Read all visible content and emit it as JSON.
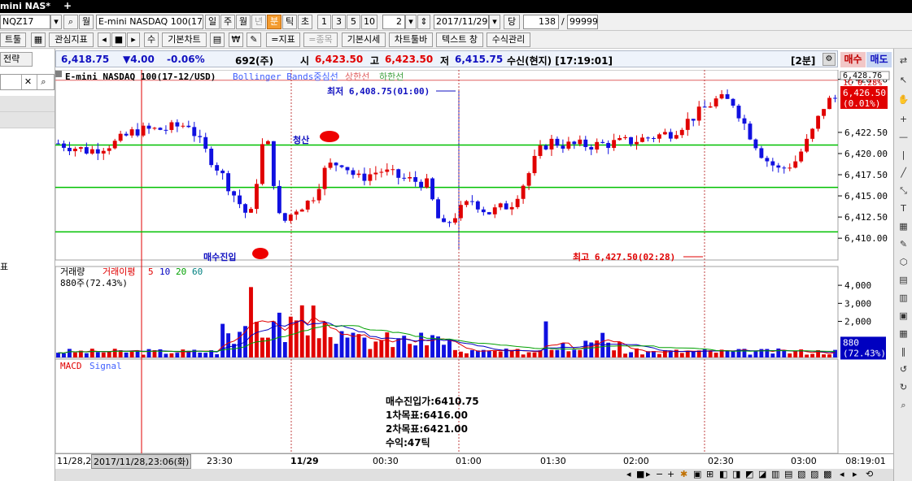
{
  "window": {
    "tab_title": "mini NAS*",
    "new_tab": "+"
  },
  "toolbar1": {
    "symbol": "NQZ17",
    "search_icon": "search-icon",
    "month_label": "월",
    "product_name": "E-mini NASDAQ 100(17-",
    "periods": [
      "일",
      "주",
      "월",
      "년",
      "분",
      "틱",
      "초"
    ],
    "active_period": "분",
    "intervals": [
      "1",
      "3",
      "5",
      "10"
    ],
    "interval_value": "2",
    "date": "2017/11/29",
    "dang_label": "당",
    "count": "138",
    "slash": "/",
    "max_count": "99999"
  },
  "toolbar2": {
    "first": "트툴",
    "interest_indicator": "관심지표",
    "number_label": "수",
    "basic_chart": "기본차트",
    "won_symbol": "₩",
    "indicator_btn": "=지표",
    "item_btn": "=종목",
    "basic_quote": "기본시세",
    "chart_toolbar": "차트툴바",
    "text_window": "텍스트 창",
    "formula_manage": "수식관리"
  },
  "left_panel": {
    "header": "전략",
    "item_label": "표"
  },
  "quote": {
    "price": "6,418.75",
    "change": "▼4.00",
    "change_pct": "-0.06%",
    "volume": "692(주)",
    "open_label": "시",
    "open": "6,423.50",
    "high_label": "고",
    "high": "6,423.50",
    "low_label": "저",
    "low": "6,415.75",
    "status": "수신(현지) [17:19:01]",
    "interval_tag": "[2분]",
    "buy_label": "매수",
    "sell_label": "매도"
  },
  "chart_data": [
    {
      "type": "candlestick",
      "title": "E-mini NASDAQ 100(17-12/USD)",
      "legend": [
        "Bollinger Bands중심선",
        "상한선",
        "하한선"
      ],
      "colors": {
        "up": "#e00000",
        "down": "#1010e0",
        "hline": "#00c000",
        "ma": "#0a8a0a"
      },
      "y_ticks": [
        "6,428.76",
        "6,422.50",
        "6,420.00",
        "6,417.50",
        "6,415.00",
        "6,412.50",
        "6,410.00"
      ],
      "ylim": [
        6408.0,
        6429.5
      ],
      "horizontal_lines": [
        6421.0,
        6416.0,
        6410.75
      ],
      "last_price_box": "6,426.50",
      "last_pct_box": "(0.01%)",
      "top_label": "1C 0.28%",
      "annotations": {
        "low_text": "최저 6,408.75(01:00)",
        "high_text": "최고 6,427.50(02:28)",
        "exit_label": "청산",
        "entry_label": "매수진입"
      }
    },
    {
      "type": "bar",
      "title": "거래량",
      "legend": [
        "거래이평",
        "5",
        "10",
        "20",
        "60"
      ],
      "info": "880주(72.43%)",
      "y_ticks": [
        "4,000",
        "3,000",
        "2,000"
      ],
      "ylim": [
        0,
        4500
      ],
      "last_value": "880",
      "last_pct": "(72.43%)"
    },
    {
      "type": "line",
      "title": "MACD",
      "legend": [
        "Signal"
      ]
    }
  ],
  "strategy_note": {
    "entry": "매수진입가:6410.75",
    "target1": "1차목표:6416.00",
    "target2": "2차목표:6421.00",
    "profit": "수익:47틱"
  },
  "xaxis": {
    "ticks": [
      "11/28,2",
      "2017/11/28,23:06(화)",
      "23:30",
      "11/29",
      "00:30",
      "01:00",
      "01:30",
      "02:00",
      "02:30",
      "03:00"
    ],
    "time_now": "08:19:01"
  }
}
